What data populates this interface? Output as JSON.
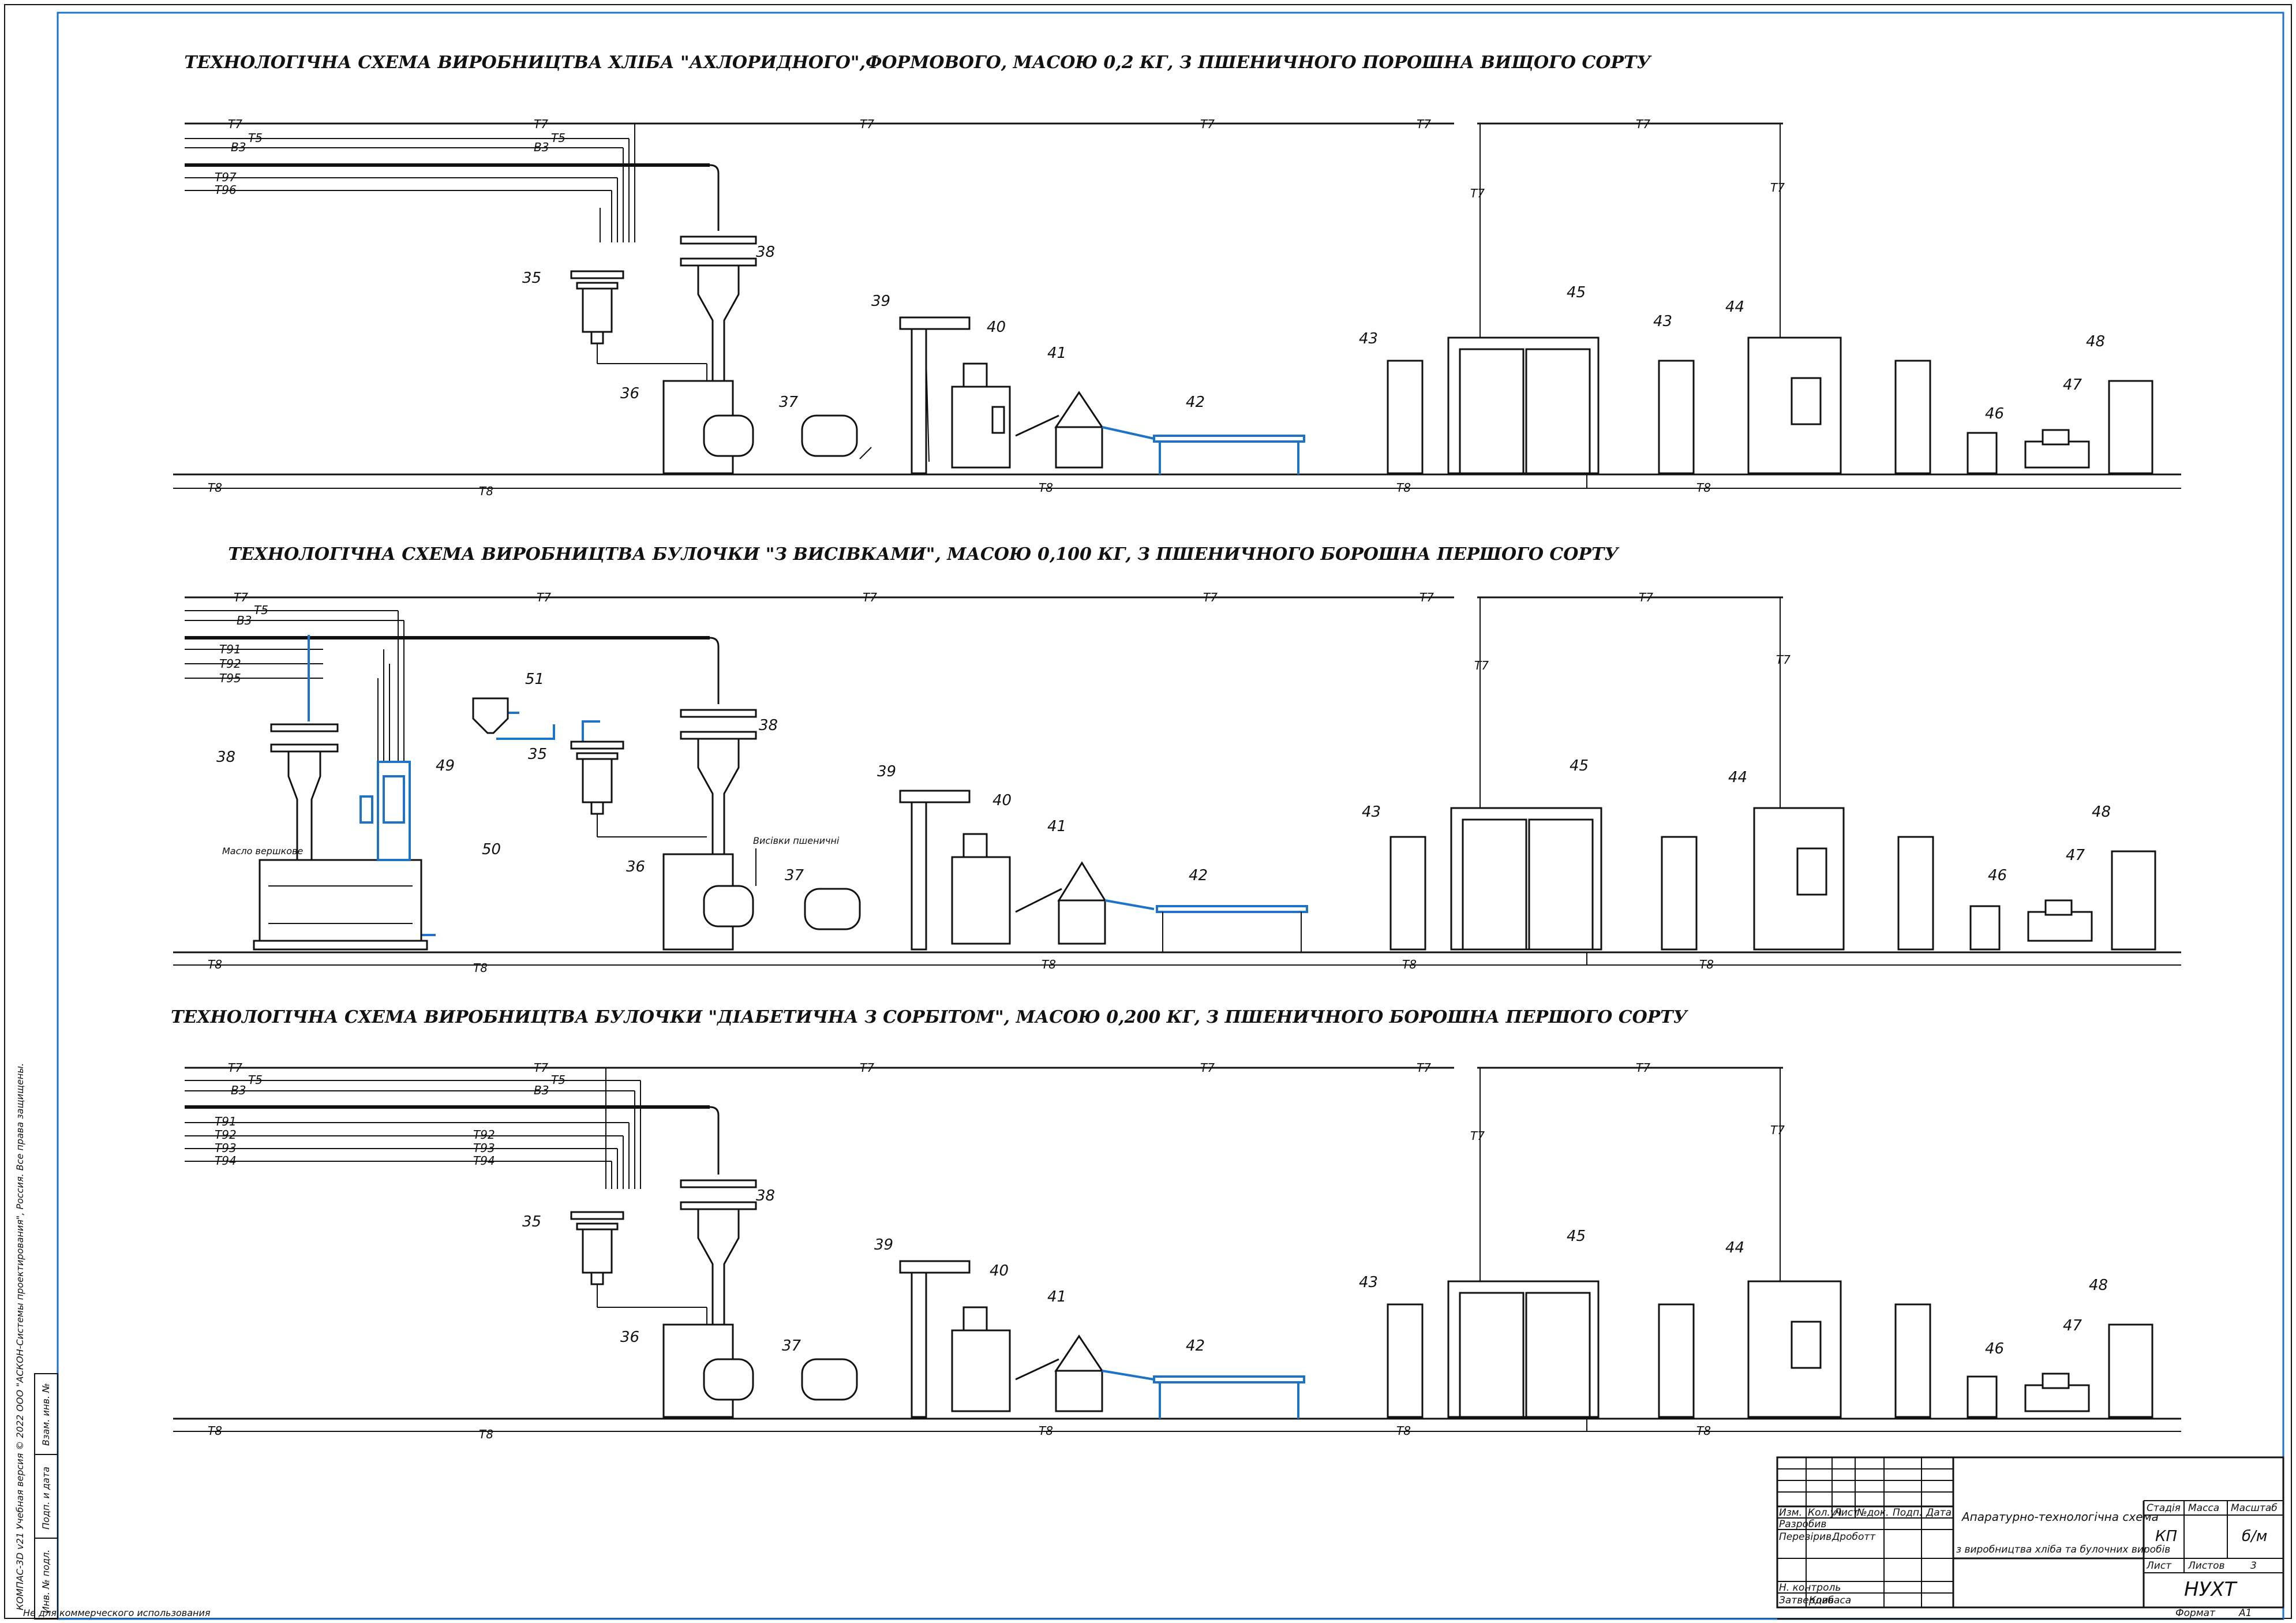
{
  "schemes": [
    {
      "title": "ТЕХНОЛОГІЧНА СХЕМА ВИРОБНИЦТВА ХЛІБА \"АХЛОРИДНОГО\",ФОРМОВОГО, МАСОЮ 0,2 КГ, З ПШЕНИЧНОГО ПОРОШНА ВИЩОГО СОРТУ",
      "left_lines": [
        "T7",
        "T5",
        "B3",
        "T97",
        "T96"
      ],
      "mid_lines": [
        "T7",
        "T5",
        "B3"
      ],
      "top_line": "T7",
      "bottom_line": "T8",
      "bottom_line_alt": "T8",
      "bottom_line_alt2": "T8",
      "bottom_line_alt3": "T8",
      "bottom_line_mark": "T8",
      "drop_labels": [
        "T7",
        "T7"
      ],
      "equipment": [
        "35",
        "36",
        "37",
        "38",
        "39",
        "40",
        "41",
        "42",
        "43",
        "45",
        "43",
        "44",
        "46",
        "47",
        "48"
      ]
    },
    {
      "title": "ТЕХНОЛОГІЧНА СХЕМА ВИРОБНИЦТВА БУЛОЧКИ \"З ВИСІВКАМИ\",  МАСОЮ 0,100 КГ, З ПШЕНИЧНОГО БОРОШНА ПЕРШОГО СОРТУ",
      "left_lines": [
        "T7",
        "T5",
        "B3",
        "T91",
        "T92",
        "T95"
      ],
      "top_line": "T7",
      "bottom_line": "T8",
      "bottom_line_mark": "T8",
      "drop_labels": [
        "T7",
        "T7"
      ],
      "note_oil": "Масло вершкове",
      "note_bran": "Висівки пшеничні",
      "equipment": [
        "38",
        "49",
        "50",
        "51",
        "35",
        "36",
        "37",
        "38",
        "39",
        "40",
        "41",
        "42",
        "43",
        "45",
        "44",
        "46",
        "47",
        "48"
      ]
    },
    {
      "title": "ТЕХНОЛОГІЧНА СХЕМА ВИРОБНИЦТВА БУЛОЧКИ \"ДІАБЕТИЧНА З СОРБІТОМ\",  МАСОЮ 0,200 КГ, З ПШЕНИЧНОГО БОРОШНА ПЕРШОГО СОРТУ",
      "left_lines": [
        "T7",
        "T5",
        "B3",
        "T91",
        "T92",
        "T93",
        "T94"
      ],
      "mid_lines": [
        "T7",
        "T5",
        "B3",
        "T92",
        "T93",
        "T94"
      ],
      "top_line": "T7",
      "bottom_line": "T8",
      "bottom_line_mark": "T8",
      "drop_labels": [
        "T7",
        "T7"
      ],
      "equipment": [
        "35",
        "36",
        "37",
        "38",
        "39",
        "40",
        "41",
        "42",
        "43",
        "45",
        "44",
        "46",
        "47",
        "48"
      ]
    }
  ],
  "title_block": {
    "doc_title_1": "Апаратурно-технологічна схема",
    "doc_title_2": "з виробництва хліба та булочних виробів",
    "stage_hdr": "Стадія",
    "mass_hdr": "Масса",
    "scale_hdr": "Масштаб",
    "stage_val": "КП",
    "scale_val": "б/м",
    "sheet_hdr": "Лист",
    "sheets_hdr": "Листов",
    "sheets_val": "3",
    "org": "НУХТ",
    "col_izm": "Изм.",
    "col_kolvo": "Кол.уч",
    "col_list": "Лист",
    "col_ndok": "№док.",
    "col_podp": "Подп.",
    "col_data": "Дата",
    "row_razrab": "Разробив",
    "row_prov": "Перевірив",
    "prov_name": "Дроботт",
    "row_nkontr": "Н. контроль",
    "row_utv": "Затвердив",
    "utv_name": "Ковбаса",
    "format_lbl": "Формат",
    "format_val": "А1"
  },
  "side_strip": {
    "c1": "Взам. инв. №",
    "c2": "Подп. и дата",
    "c3": "Инв. № подл.",
    "software": "КОМПАС-3D v21 Учебная версия © 2022 ООО \"АСКОН-Системы проектирования\", Россия. Все права защищены.",
    "noncommercial": "Не для коммерческого использования"
  }
}
